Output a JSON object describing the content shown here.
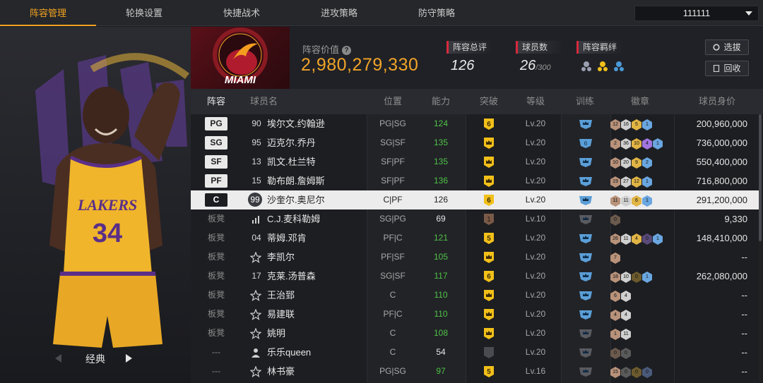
{
  "tabs": [
    {
      "label": "阵容管理",
      "active": true
    },
    {
      "label": "轮换设置",
      "active": false
    },
    {
      "label": "快捷战术",
      "active": false
    },
    {
      "label": "进攻策略",
      "active": false
    },
    {
      "label": "防守策略",
      "active": false
    }
  ],
  "team_select": {
    "value": "111111"
  },
  "left_panel": {
    "card_label": "经典"
  },
  "summary": {
    "value_label": "阵容价值",
    "value": "2,980,279,330",
    "rating_label": "阵容总评",
    "rating": "126",
    "count_label": "球员数",
    "count": "26",
    "count_max": "/300",
    "bond_label": "阵容羁绊",
    "scout_button": "选拔",
    "recycle_button": "回收",
    "logo_text": "MIAMI"
  },
  "columns": {
    "lineup": "阵容",
    "name": "球员名",
    "position": "位置",
    "ability": "能力",
    "breakthrough": "突破",
    "level": "等级",
    "training": "训练",
    "badges": "徽章",
    "value": "球员身价"
  },
  "colors": {
    "accent": "#f3a320",
    "ability_green": "#4fc247",
    "red_mark": "#d8293c",
    "break_gold": "#f2c019"
  },
  "rows": [
    {
      "lineup": "PG",
      "starter": true,
      "num": "90",
      "name": "埃尔文.约翰逊",
      "position": "PG|SG",
      "ability": "124",
      "break": "6",
      "level": "Lv.20",
      "train": "blue",
      "badges": [
        "12",
        "16",
        "5",
        "1"
      ],
      "badge_colors": [
        "#b8927a",
        "#cfcfcf",
        "#e0b445",
        "#6aa6e0"
      ],
      "price": "200,960,000"
    },
    {
      "lineup": "SG",
      "starter": true,
      "num": "95",
      "name": "迈克尔.乔丹",
      "position": "SG|SF",
      "ability": "135",
      "break": "crown",
      "level": "Lv.20",
      "train": "6",
      "badges": [
        "2",
        "36",
        "10",
        "4",
        "1"
      ],
      "badge_colors": [
        "#b8927a",
        "#cfcfcf",
        "#e0b445",
        "#a275e0",
        "#6aa6e0"
      ],
      "price": "736,000,000"
    },
    {
      "lineup": "SF",
      "starter": true,
      "num": "13",
      "name": "凯文.杜兰特",
      "position": "SF|PF",
      "ability": "135",
      "break": "crown",
      "level": "Lv.20",
      "train": "blue",
      "badges": [
        "10",
        "20",
        "9",
        "2"
      ],
      "badge_colors": [
        "#b8927a",
        "#cfcfcf",
        "#e0b445",
        "#6aa6e0"
      ],
      "price": "550,400,000"
    },
    {
      "lineup": "PF",
      "starter": true,
      "num": "15",
      "name": "勒布朗.詹姆斯",
      "position": "SF|PF",
      "ability": "136",
      "break": "crown",
      "level": "Lv.20",
      "train": "blue",
      "badges": [
        "19",
        "27",
        "12",
        "1"
      ],
      "badge_colors": [
        "#b8927a",
        "#cfcfcf",
        "#e0b445",
        "#6aa6e0"
      ],
      "price": "716,800,000"
    },
    {
      "lineup": "C",
      "starter": true,
      "selected": true,
      "num": "99",
      "name": "沙奎尔.奥尼尔",
      "position": "C|PF",
      "ability": "126",
      "break": "6",
      "level": "Lv.20",
      "train": "blue",
      "badges": [
        "11",
        "11",
        "6",
        "1"
      ],
      "badge_colors": [
        "#b8927a",
        "#cfcfcf",
        "#e0b445",
        "#6aa6e0"
      ],
      "price": "291,200,000"
    },
    {
      "lineup": "板凳",
      "starter": false,
      "num": "",
      "name": "C.J.麦科勒姆",
      "position": "SG|PG",
      "ability": "69",
      "break": "1",
      "level": "Lv.10",
      "train": "grey",
      "badges": [
        "0"
      ],
      "badge_colors": [
        "#6b5a4d"
      ],
      "price": "9,330",
      "ability_white": true
    },
    {
      "lineup": "板凳",
      "starter": false,
      "num": "04",
      "name": "蒂姆.邓肯",
      "position": "PF|C",
      "ability": "121",
      "break": "5",
      "level": "Lv.20",
      "train": "blue",
      "badges": [
        "26",
        "11",
        "4",
        "0",
        "1"
      ],
      "badge_colors": [
        "#b8927a",
        "#cfcfcf",
        "#e0b445",
        "#5a4a7a",
        "#6aa6e0"
      ],
      "price": "148,410,000"
    },
    {
      "lineup": "板凳",
      "starter": false,
      "num": "",
      "name": "李凯尔",
      "position": "PF|SF",
      "ability": "105",
      "break": "crown",
      "level": "Lv.20",
      "train": "blue",
      "badges": [
        "7"
      ],
      "badge_colors": [
        "#b8927a"
      ],
      "price": "--"
    },
    {
      "lineup": "板凳",
      "starter": false,
      "num": "17",
      "name": "克莱.汤普森",
      "position": "SG|SF",
      "ability": "117",
      "break": "6",
      "level": "Lv.20",
      "train": "blue",
      "badges": [
        "18",
        "10",
        "0",
        "1"
      ],
      "badge_colors": [
        "#b8927a",
        "#cfcfcf",
        "#6b5a2d",
        "#6aa6e0"
      ],
      "price": "262,080,000"
    },
    {
      "lineup": "板凳",
      "starter": false,
      "num": "",
      "name": "王治郅",
      "position": "C",
      "ability": "110",
      "break": "crown",
      "level": "Lv.20",
      "train": "blue",
      "badges": [
        "6",
        "4"
      ],
      "badge_colors": [
        "#b8927a",
        "#cfcfcf"
      ],
      "price": "--"
    },
    {
      "lineup": "板凳",
      "starter": false,
      "num": "",
      "name": "易建联",
      "position": "PF|C",
      "ability": "110",
      "break": "crown",
      "level": "Lv.20",
      "train": "blue",
      "badges": [
        "4",
        "4"
      ],
      "badge_colors": [
        "#b8927a",
        "#cfcfcf"
      ],
      "price": "--"
    },
    {
      "lineup": "板凳",
      "starter": false,
      "num": "",
      "name": "姚明",
      "position": "C",
      "ability": "108",
      "break": "crown",
      "level": "Lv.20",
      "train": "grey",
      "badges": [
        "1",
        "11"
      ],
      "badge_colors": [
        "#b8927a",
        "#cfcfcf"
      ],
      "price": "--"
    },
    {
      "lineup": "---",
      "starter": false,
      "num": "",
      "name": "乐乐queen",
      "position": "C",
      "ability": "54",
      "break": "grey",
      "level": "Lv.20",
      "train": "grey",
      "badges": [
        "0",
        "0"
      ],
      "badge_colors": [
        "#6b5a4d",
        "#5a5a5a"
      ],
      "price": "--",
      "ability_white": true
    },
    {
      "lineup": "---",
      "starter": false,
      "num": "",
      "name": "林书豪",
      "position": "PG|SG",
      "ability": "97",
      "break": "5",
      "level": "Lv.16",
      "train": "grey",
      "badges": [
        "15",
        "0",
        "0",
        "0"
      ],
      "badge_colors": [
        "#b8927a",
        "#5a5a5a",
        "#6b5a2d",
        "#4a5a7a"
      ],
      "price": "--"
    }
  ]
}
